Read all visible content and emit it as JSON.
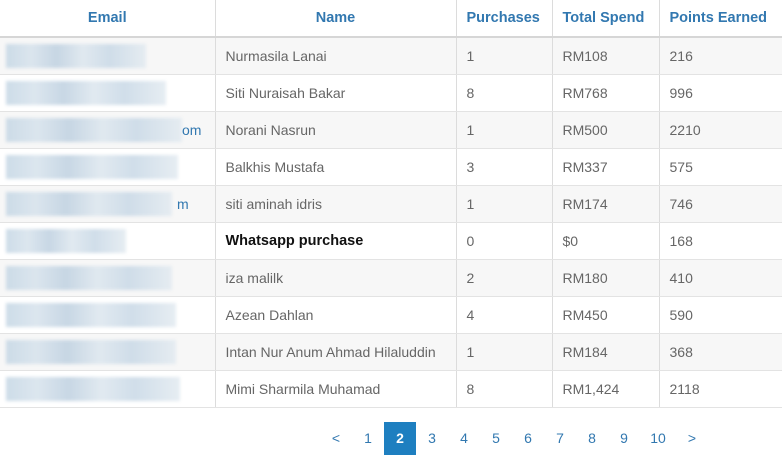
{
  "table": {
    "headers": {
      "email": "Email",
      "name": "Name",
      "purchases": "Purchases",
      "total_spend": "Total Spend",
      "points": "Points Earned"
    },
    "rows": [
      {
        "email_tail": "",
        "name": "Nurmasila Lanai",
        "purchases": "1",
        "total_spend": "RM108",
        "points": "216"
      },
      {
        "email_tail": "",
        "name": "Siti Nuraisah Bakar",
        "purchases": "8",
        "total_spend": "RM768",
        "points": "996"
      },
      {
        "email_tail": "om",
        "name": "Norani Nasrun",
        "purchases": "1",
        "total_spend": "RM500",
        "points": "2210"
      },
      {
        "email_tail": "",
        "name": "Balkhis Mustafa",
        "purchases": "3",
        "total_spend": "RM337",
        "points": "575"
      },
      {
        "email_tail": "m",
        "name": "siti aminah idris",
        "purchases": "1",
        "total_spend": "RM174",
        "points": "746"
      },
      {
        "email_tail": "",
        "name": "Whatsapp purchase",
        "purchases": "0",
        "total_spend": "$0",
        "points": "168"
      },
      {
        "email_tail": "",
        "name": "iza malilk",
        "purchases": "2",
        "total_spend": "RM180",
        "points": "410"
      },
      {
        "email_tail": "",
        "name": "Azean Dahlan",
        "purchases": "4",
        "total_spend": "RM450",
        "points": "590"
      },
      {
        "email_tail": "",
        "name": "Intan Nur Anum Ahmad Hilaluddin",
        "purchases": "1",
        "total_spend": "RM184",
        "points": "368"
      },
      {
        "email_tail": "",
        "name": "Mimi Sharmila Muhamad",
        "purchases": "8",
        "total_spend": "RM1,424",
        "points": "2118"
      }
    ]
  },
  "pagination": {
    "prev": "<",
    "pages": [
      "1",
      "2",
      "3",
      "4",
      "5",
      "6",
      "7",
      "8",
      "9",
      "10"
    ],
    "current": "2",
    "next": ">"
  }
}
